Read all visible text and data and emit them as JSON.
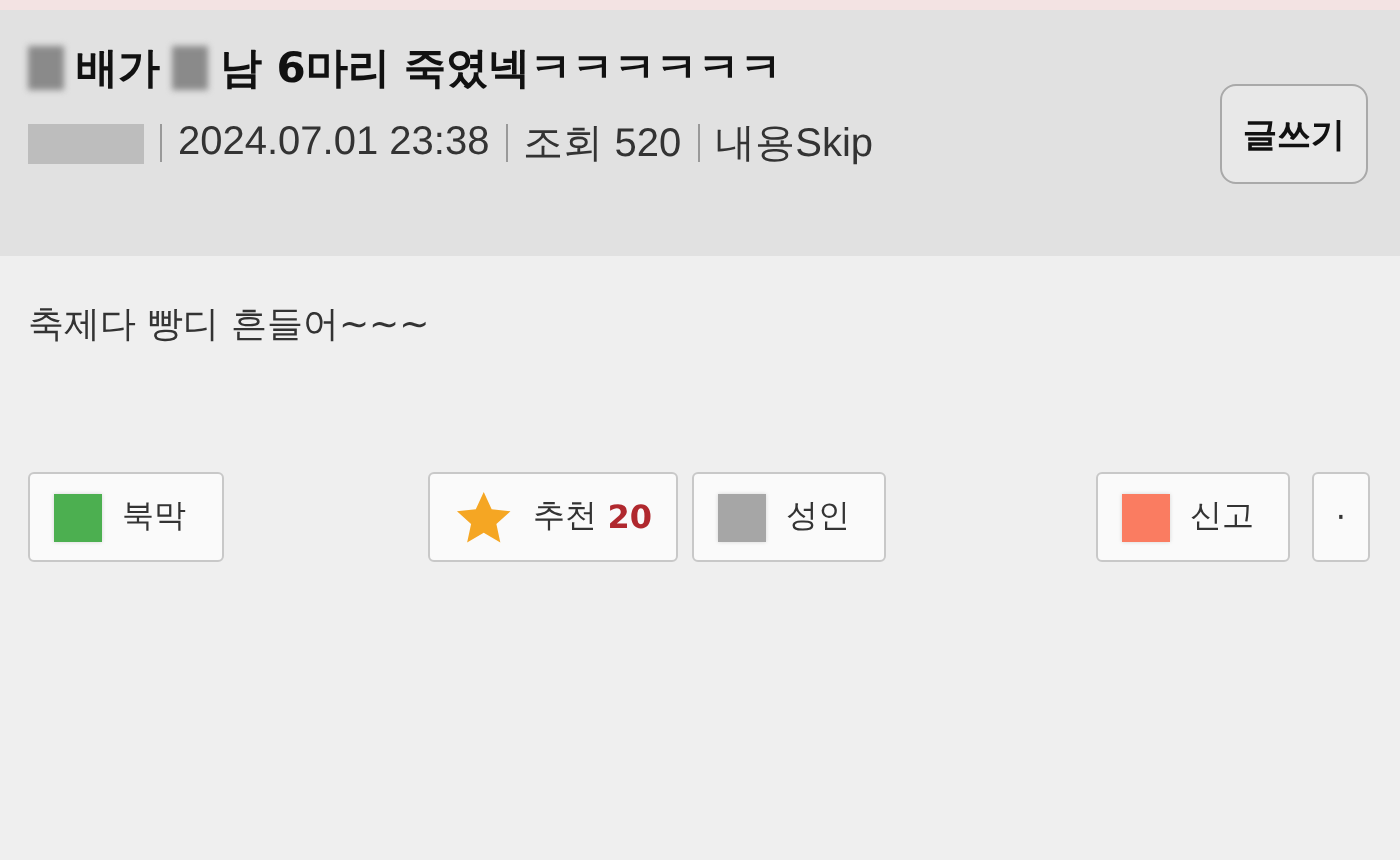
{
  "post": {
    "title_parts": [
      {
        "kind": "censored"
      },
      {
        "kind": "text",
        "text": "배가"
      },
      {
        "kind": "censored"
      },
      {
        "kind": "text",
        "text": "남 6마리 죽였넥ㅋㅋㅋㅋㅋㅋ"
      }
    ],
    "meta": [
      {
        "kind": "censored"
      },
      {
        "kind": "text",
        "text": "2024.07.01 23:38"
      },
      {
        "kind": "text",
        "text": "조회 520"
      },
      {
        "kind": "text",
        "text": "내용Skip"
      }
    ],
    "write_button": "글쓰기",
    "body": "축제다 빵디 흔들어~~~"
  },
  "action_bar": {
    "left": [
      {
        "kind": "square",
        "color": "#4caf50",
        "label": "북막"
      }
    ],
    "center": [
      {
        "kind": "star",
        "label": "추천",
        "count": "20"
      },
      {
        "kind": "square",
        "color": "#a6a6a6",
        "label": "성인"
      }
    ],
    "right": [
      {
        "kind": "square",
        "color": "#fa7c61",
        "label": "신고"
      },
      {
        "kind": "plain",
        "label": "·"
      }
    ]
  }
}
